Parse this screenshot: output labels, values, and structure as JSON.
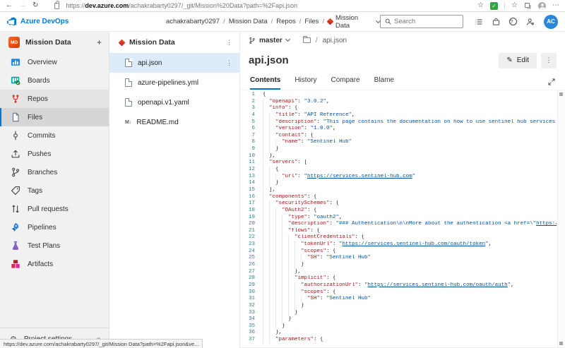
{
  "browser": {
    "url_scheme": "https://",
    "url_host": "dev.azure.com",
    "url_rest": "/achakrabarty0297/_git/Mission%20Data?path=%2Fapi.json",
    "status_url": "https://dev.azure.com/achakrabarty0297/_git/Mission Data?path=%2Fapi.json&ve..."
  },
  "icons": {
    "back": "←",
    "forward": "→",
    "refresh": "↻",
    "star": "☆",
    "fav_star": "☆",
    "check": "✓",
    "more": "⋯",
    "kebab": "⋮",
    "plus": "+",
    "collapse": "«",
    "gear": "⚙",
    "pencil": "✎",
    "help": "?",
    "md": "M↓"
  },
  "header": {
    "brand": "Azure DevOps",
    "breadcrumb": [
      "achakrabarty0297",
      "Mission Data",
      "Repos",
      "Files"
    ],
    "repo_selector": "Mission Data",
    "search_placeholder": "Search"
  },
  "avatar": "AC",
  "sidebar": {
    "project": "Mission Data",
    "project_initials": "MD",
    "items": [
      {
        "label": "Overview",
        "icon": "overview"
      },
      {
        "label": "Boards",
        "icon": "boards"
      },
      {
        "label": "Repos",
        "icon": "repos",
        "hub": true
      },
      {
        "label": "Files",
        "icon": "files",
        "selected": true
      },
      {
        "label": "Commits",
        "icon": "commits"
      },
      {
        "label": "Pushes",
        "icon": "pushes"
      },
      {
        "label": "Branches",
        "icon": "branches"
      },
      {
        "label": "Tags",
        "icon": "tags"
      },
      {
        "label": "Pull requests",
        "icon": "pull-requests"
      },
      {
        "label": "Pipelines",
        "icon": "pipelines"
      },
      {
        "label": "Test Plans",
        "icon": "test-plans"
      },
      {
        "label": "Artifacts",
        "icon": "artifacts"
      }
    ],
    "settings_label": "Project settings"
  },
  "file_tree": {
    "repo": "Mission Data",
    "items": [
      {
        "name": "api.json",
        "icon": "doc",
        "selected": true
      },
      {
        "name": "azure-pipelines.yml",
        "icon": "doc"
      },
      {
        "name": "openapi.v1.yaml",
        "icon": "doc"
      },
      {
        "name": "README.md",
        "icon": "md"
      }
    ]
  },
  "content": {
    "branch": "master",
    "path_file": "api.json",
    "path_sep": "/",
    "title": "api.json",
    "edit_label": "Edit",
    "tabs": [
      "Contents",
      "History",
      "Compare",
      "Blame"
    ],
    "active_tab": "Contents"
  },
  "code": {
    "lines": [
      {
        "i": 0,
        "s": [
          [
            "p",
            "{"
          ]
        ]
      },
      {
        "i": 1,
        "s": [
          [
            "k",
            "\"openapi\""
          ],
          [
            "p",
            ": "
          ],
          [
            "v",
            "\"3.0.2\""
          ],
          [
            "p",
            ","
          ]
        ]
      },
      {
        "i": 1,
        "s": [
          [
            "k",
            "\"info\""
          ],
          [
            "p",
            ": {"
          ]
        ]
      },
      {
        "i": 2,
        "s": [
          [
            "k",
            "\"title\""
          ],
          [
            "p",
            ": "
          ],
          [
            "v",
            "\"API Reference\""
          ],
          [
            "p",
            ","
          ]
        ]
      },
      {
        "i": 2,
        "s": [
          [
            "k",
            "\"description\""
          ],
          [
            "p",
            ": "
          ],
          [
            "v",
            "\"This page contains the documentation on how to use sentinel hub services through API calls"
          ]
        ]
      },
      {
        "i": 2,
        "s": [
          [
            "k",
            "\"version\""
          ],
          [
            "p",
            ": "
          ],
          [
            "v",
            "\"1.0.0\""
          ],
          [
            "p",
            ","
          ]
        ]
      },
      {
        "i": 2,
        "s": [
          [
            "k",
            "\"contact\""
          ],
          [
            "p",
            ": {"
          ]
        ]
      },
      {
        "i": 3,
        "s": [
          [
            "k",
            "\"name\""
          ],
          [
            "p",
            ": "
          ],
          [
            "v",
            "\"Sentinel Hub\""
          ]
        ]
      },
      {
        "i": 2,
        "s": [
          [
            "p",
            "}"
          ]
        ]
      },
      {
        "i": 1,
        "s": [
          [
            "p",
            "},"
          ]
        ]
      },
      {
        "i": 1,
        "s": [
          [
            "k",
            "\"servers\""
          ],
          [
            "p",
            ": ["
          ]
        ]
      },
      {
        "i": 2,
        "s": [
          [
            "p",
            "{"
          ]
        ]
      },
      {
        "i": 3,
        "s": [
          [
            "k",
            "\"url\""
          ],
          [
            "p",
            ": "
          ],
          [
            "v",
            "\""
          ],
          [
            "u",
            "https://services.sentinel-hub.com"
          ],
          [
            "v",
            "\""
          ]
        ]
      },
      {
        "i": 2,
        "s": [
          [
            "p",
            "}"
          ]
        ]
      },
      {
        "i": 1,
        "s": [
          [
            "p",
            "],"
          ]
        ]
      },
      {
        "i": 1,
        "s": [
          [
            "k",
            "\"components\""
          ],
          [
            "p",
            ": {"
          ]
        ]
      },
      {
        "i": 2,
        "s": [
          [
            "k",
            "\"securitySchemes\""
          ],
          [
            "p",
            ": {"
          ]
        ]
      },
      {
        "i": 3,
        "s": [
          [
            "k",
            "\"OAuth2\""
          ],
          [
            "p",
            ": {"
          ]
        ]
      },
      {
        "i": 4,
        "s": [
          [
            "k",
            "\"type\""
          ],
          [
            "p",
            ": "
          ],
          [
            "v",
            "\"oauth2\""
          ],
          [
            "p",
            ","
          ]
        ]
      },
      {
        "i": 4,
        "s": [
          [
            "k",
            "\"description\""
          ],
          [
            "p",
            ": "
          ],
          [
            "v",
            "\"### Authentication\\n\\nMore about the authentication <a href=\\\""
          ],
          [
            "u",
            "https://docs.sentinel-hub.com"
          ]
        ]
      },
      {
        "i": 4,
        "s": [
          [
            "k",
            "\"flows\""
          ],
          [
            "p",
            ": {"
          ]
        ]
      },
      {
        "i": 5,
        "s": [
          [
            "k",
            "\"clientCredentials\""
          ],
          [
            "p",
            ": {"
          ]
        ]
      },
      {
        "i": 6,
        "s": [
          [
            "k",
            "\"tokenUrl\""
          ],
          [
            "p",
            ": "
          ],
          [
            "v",
            "\""
          ],
          [
            "u",
            "https://services.sentinel-hub.com/oauth/token"
          ],
          [
            "v",
            "\""
          ],
          [
            "p",
            ","
          ]
        ]
      },
      {
        "i": 6,
        "s": [
          [
            "k",
            "\"scopes\""
          ],
          [
            "p",
            ": {"
          ]
        ]
      },
      {
        "i": 7,
        "s": [
          [
            "k",
            "\"SH\""
          ],
          [
            "p",
            ": "
          ],
          [
            "v",
            "\"Sentinel Hub\""
          ]
        ]
      },
      {
        "i": 6,
        "s": [
          [
            "p",
            "}"
          ]
        ]
      },
      {
        "i": 5,
        "s": [
          [
            "p",
            "},"
          ]
        ]
      },
      {
        "i": 5,
        "s": [
          [
            "k",
            "\"implicit\""
          ],
          [
            "p",
            ": {"
          ]
        ]
      },
      {
        "i": 6,
        "s": [
          [
            "k",
            "\"authorizationUrl\""
          ],
          [
            "p",
            ": "
          ],
          [
            "v",
            "\""
          ],
          [
            "u",
            "https://services.sentinel-hub.com/oauth/auth"
          ],
          [
            "v",
            "\""
          ],
          [
            "p",
            ","
          ]
        ]
      },
      {
        "i": 6,
        "s": [
          [
            "k",
            "\"scopes\""
          ],
          [
            "p",
            ": {"
          ]
        ]
      },
      {
        "i": 7,
        "s": [
          [
            "k",
            "\"SH\""
          ],
          [
            "p",
            ": "
          ],
          [
            "v",
            "\"Sentinel Hub\""
          ]
        ]
      },
      {
        "i": 6,
        "s": [
          [
            "p",
            "}"
          ]
        ]
      },
      {
        "i": 5,
        "s": [
          [
            "p",
            "}"
          ]
        ]
      },
      {
        "i": 4,
        "s": [
          [
            "p",
            "}"
          ]
        ]
      },
      {
        "i": 3,
        "s": [
          [
            "p",
            "}"
          ]
        ]
      },
      {
        "i": 2,
        "s": [
          [
            "p",
            "},"
          ]
        ]
      },
      {
        "i": 2,
        "s": [
          [
            "k",
            "\"parameters\""
          ],
          [
            "p",
            ": {"
          ]
        ]
      }
    ]
  },
  "colors": {
    "accent": "#0078d4",
    "json_key": "#a31515",
    "json_value": "#0451a5",
    "selected_file_bg": "#deecf9"
  }
}
